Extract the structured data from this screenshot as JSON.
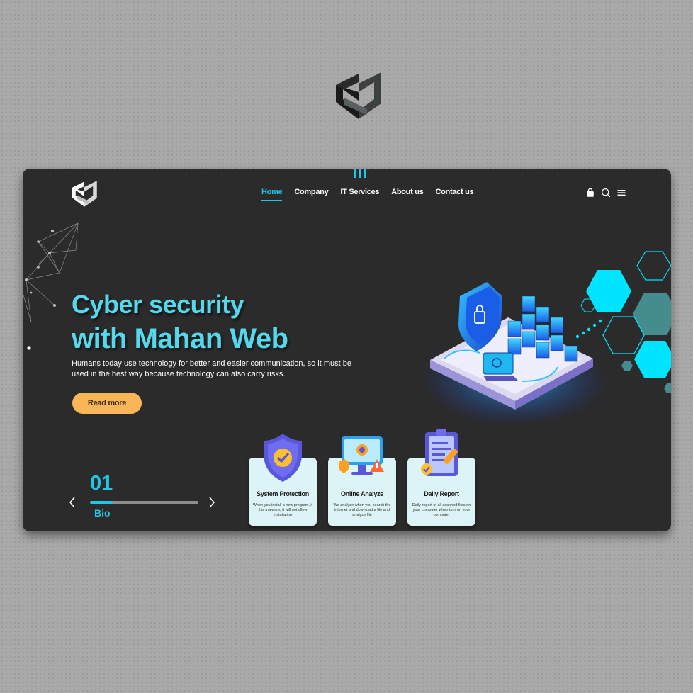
{
  "brand": {
    "logo_name": "mahan-web-logo"
  },
  "nav": {
    "items": [
      {
        "label": "Home",
        "active": true
      },
      {
        "label": "Company",
        "active": false
      },
      {
        "label": "IT Services",
        "active": false
      },
      {
        "label": "About us",
        "active": false
      },
      {
        "label": "Contact us",
        "active": false
      }
    ],
    "icons": [
      "bag-icon",
      "search-icon",
      "menu-icon"
    ]
  },
  "hero": {
    "title_line1": "Cyber security",
    "title_line2": "with Mahan Web",
    "description": "Humans today use technology for better and easier communication, so it must be used in the best way because technology can also carry risks.",
    "cta_label": "Read more"
  },
  "slider": {
    "number": "01",
    "label": "Bio",
    "progress": 0.21
  },
  "cards": [
    {
      "title": "System Protection",
      "description": "When you install a new program, if it is malware, it will not allow installation",
      "icon": "shield-check-icon"
    },
    {
      "title": "Online Analyze",
      "description": "We analyze when you search the internet and download a file and analyze file",
      "icon": "monitor-virus-icon"
    },
    {
      "title": "Daily Report",
      "description": "Daily report of all scanned files on your computer when turn on your computer",
      "icon": "clipboard-report-icon"
    }
  ],
  "colors": {
    "accent": "#1ec7e6",
    "title": "#55d8ec",
    "button": "#f8b659",
    "panel": "#2b2b2c",
    "card": "#dcf4f5"
  }
}
